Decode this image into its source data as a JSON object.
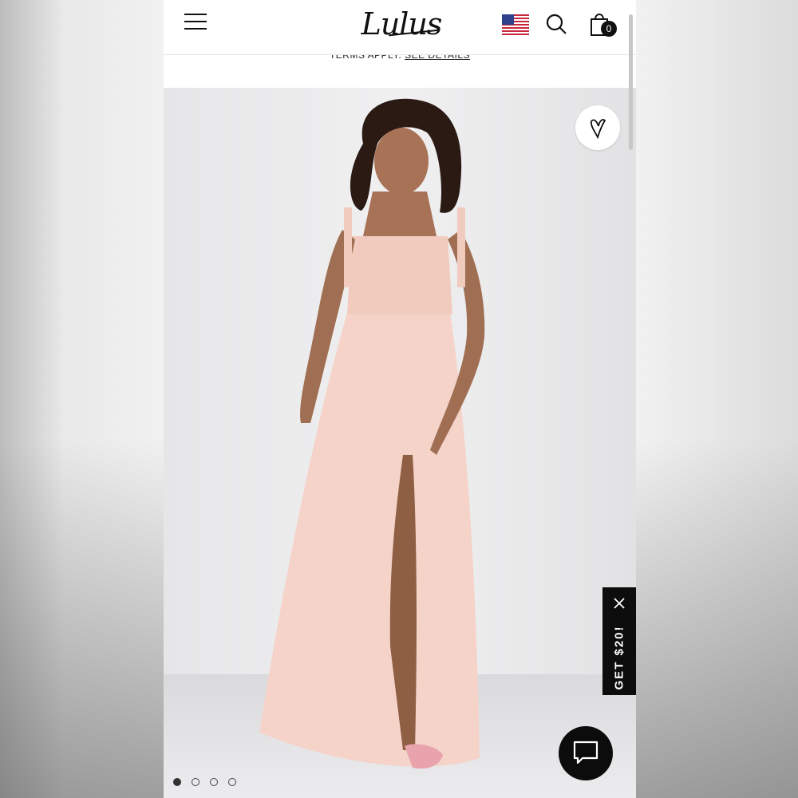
{
  "header": {
    "brand": "Lulus",
    "cart_count": "0"
  },
  "promo": {
    "terms_text": "TERMS APPLY.",
    "link_text": "SEE DETAILS"
  },
  "icons": [
    "menu-icon",
    "us-flag-icon",
    "search-icon",
    "shopping-bag-icon",
    "heart-icon",
    "close-icon",
    "chat-icon"
  ],
  "popup": {
    "label": "GET $20!"
  },
  "carousel": {
    "total": 4,
    "active_index": 0
  },
  "colors": {
    "dress": "#f5d3c9",
    "accent": "#111111"
  }
}
